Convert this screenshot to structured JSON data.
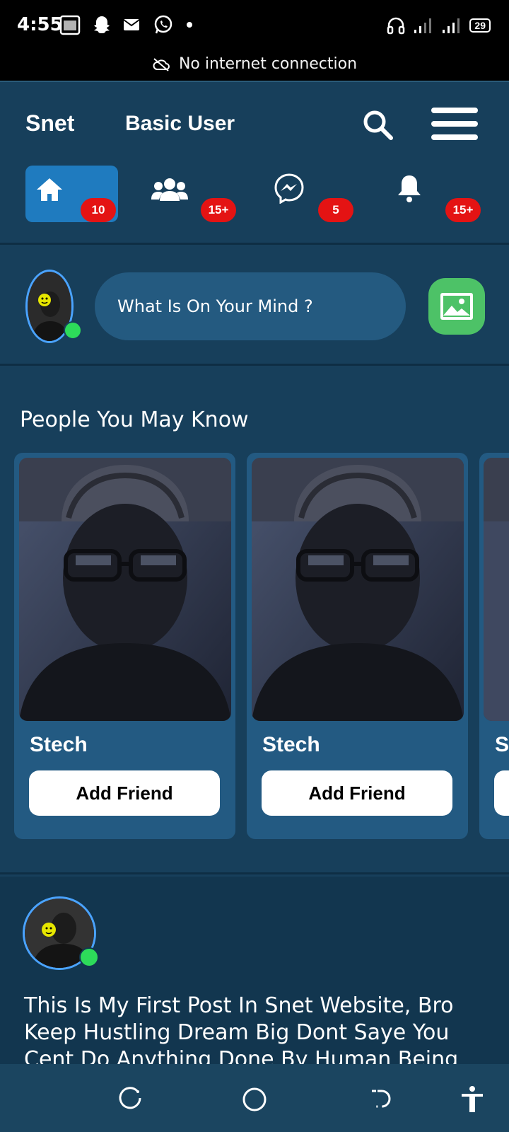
{
  "status_bar": {
    "time": "4:55",
    "battery": "29",
    "left_icons": [
      "calendar-icon",
      "snapchat-icon",
      "mail-icon",
      "whatsapp-icon",
      "dot-icon"
    ],
    "right_icons": [
      "headset-icon",
      "signal-icon",
      "signal-icon",
      "battery-icon"
    ]
  },
  "connectivity_banner": {
    "text": "No internet connection",
    "icon": "cloud-off-icon"
  },
  "header": {
    "brand": "Snet",
    "user_role": "Basic User",
    "search_icon": "search-icon",
    "menu_icon": "hamburger-menu-icon"
  },
  "nav_tabs": [
    {
      "name": "home",
      "icon": "home-icon",
      "badge": "10",
      "active": true
    },
    {
      "name": "friends",
      "icon": "users-icon",
      "badge": "15+",
      "active": false
    },
    {
      "name": "messenger",
      "icon": "messenger-icon",
      "badge": "5",
      "active": false
    },
    {
      "name": "notifications",
      "icon": "bell-icon",
      "badge": "15+",
      "active": false
    }
  ],
  "composer": {
    "placeholder": "What Is On Your Mind ?",
    "photo_icon": "image-icon"
  },
  "people_you_may_know": {
    "title": "People You May Know",
    "cards": [
      {
        "name": "Stech",
        "button": "Add Friend"
      },
      {
        "name": "Stech",
        "button": "Add Friend"
      },
      {
        "name": "S",
        "button": ""
      }
    ]
  },
  "post": {
    "text": "This Is My First Post In Snet Website, Bro Keep Hustling Dream Big Dont Saye You Cent Do Anything Done By Human Being Like U"
  },
  "system_nav": [
    "recents-icon",
    "home-circle-icon",
    "back-icon",
    "accessibility-icon"
  ],
  "colors": {
    "background": "#173f5b",
    "active_tab": "#1f7bbf",
    "badge": "#e41313",
    "online": "#2ddb5a",
    "card": "#235a82",
    "image_button": "#4dc267"
  }
}
